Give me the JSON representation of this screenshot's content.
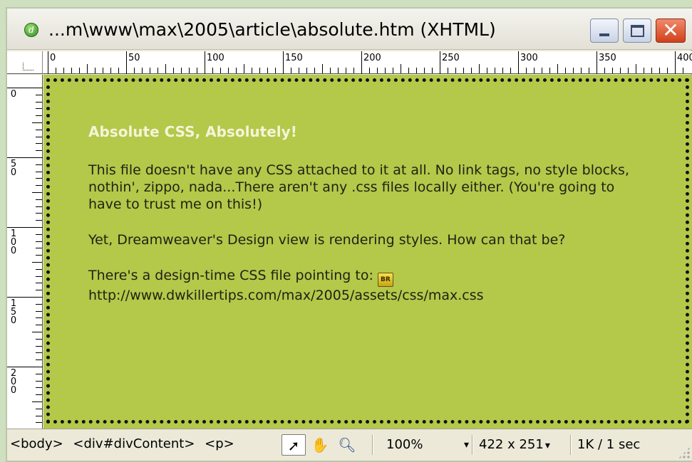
{
  "window": {
    "title": "...m\\www\\max\\2005\\article\\absolute.htm (XHTML)",
    "app_icon": "dreamweaver-icon",
    "controls": {
      "minimize": "minimize-icon",
      "maximize": "maximize-icon",
      "close": "close-icon",
      "close_glyph": "✕"
    }
  },
  "ruler": {
    "horizontal": [
      "0",
      "50",
      "100",
      "150",
      "200",
      "250",
      "300",
      "350",
      "400"
    ],
    "vertical": [
      [
        "0"
      ],
      [
        "5",
        "0"
      ],
      [
        "1",
        "0",
        "0"
      ],
      [
        "1",
        "5",
        "0"
      ],
      [
        "2",
        "0",
        "0"
      ]
    ]
  },
  "document": {
    "heading": "Absolute CSS, Absolutely!",
    "paragraphs": [
      "This file doesn't have any CSS attached to it at all. No link tags, no style blocks, nothin', zippo, nada...There aren't any .css files locally either. (You're going to have to trust me on this!)",
      "Yet, Dreamweaver's Design view is rendering styles. How can that be?"
    ],
    "design_time_note": "There's a design-time CSS file pointing to:",
    "design_time_url": "http://www.dwkillertips.com/max/2005/assets/css/max.css",
    "colors": {
      "canvas": "#b4c84a",
      "heading": "#f4f4d8",
      "text": "#222214"
    }
  },
  "statusbar": {
    "tags": [
      "<body>",
      "<div#divContent>",
      "<p>"
    ],
    "tools": {
      "select": "arrow-pointer-icon",
      "hand": "hand-icon",
      "zoom": "magnifier-icon"
    },
    "zoom": "100%",
    "window_size": "422 x 251",
    "download": "1K / 1 sec"
  }
}
